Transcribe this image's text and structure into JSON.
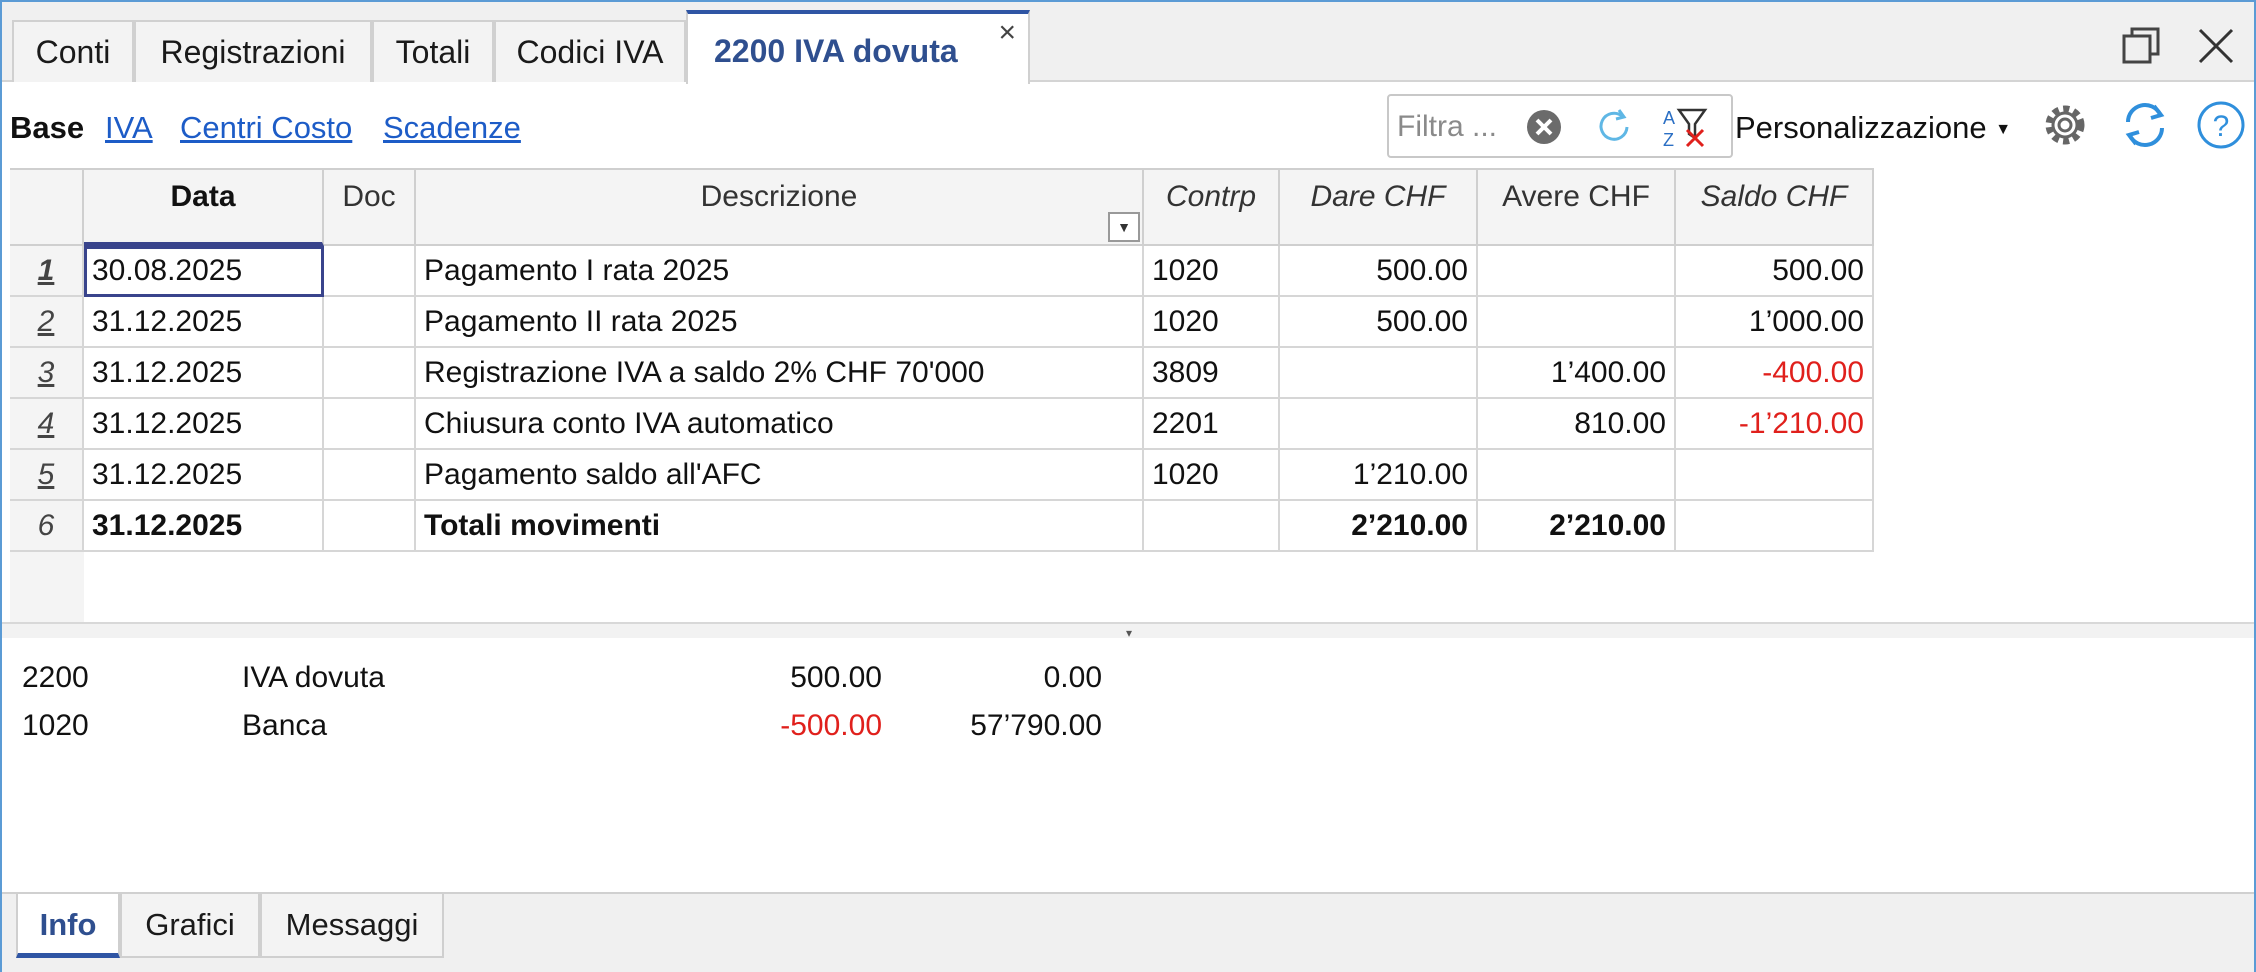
{
  "tabs": [
    {
      "label": "Conti"
    },
    {
      "label": "Registrazioni"
    },
    {
      "label": "Totali"
    },
    {
      "label": "Codici IVA"
    },
    {
      "label": "2200 IVA dovuta"
    }
  ],
  "tab_close_symbol": "×",
  "views": {
    "active": "Base",
    "links": [
      "IVA",
      "Centri Costo",
      "Scadenze"
    ]
  },
  "filter": {
    "placeholder": "Filtra ..."
  },
  "customize_label": "Personalizzazione",
  "icons": {
    "restore": "restore-window-icon",
    "close": "close-window-icon",
    "clear": "clear-filter-icon",
    "refresh": "refresh-filter-icon",
    "sort_filter": "sort-filter-icon",
    "settings": "gear-icon",
    "sync": "sync-icon",
    "help": "help-icon"
  },
  "colors": {
    "accent": "#2f55a4",
    "link": "#1d5cc7",
    "negative": "#e0201c"
  },
  "table": {
    "headers": [
      "Data",
      "Doc",
      "Descrizione",
      "Contrp",
      "Dare CHF",
      "Avere CHF",
      "Saldo CHF"
    ],
    "rows": [
      {
        "n": "1",
        "data": "30.08.2025",
        "doc": "",
        "descr": "Pagamento I rata 2025",
        "contrp": "1020",
        "dare": "500.00",
        "avere": "",
        "saldo": "500.00"
      },
      {
        "n": "2",
        "data": "31.12.2025",
        "doc": "",
        "descr": "Pagamento II rata 2025",
        "contrp": "1020",
        "dare": "500.00",
        "avere": "",
        "saldo": "1’000.00"
      },
      {
        "n": "3",
        "data": "31.12.2025",
        "doc": "",
        "descr": "Registrazione IVA a saldo 2% CHF 70'000",
        "contrp": "3809",
        "dare": "",
        "avere": "1’400.00",
        "saldo": "-400.00"
      },
      {
        "n": "4",
        "data": "31.12.2025",
        "doc": "",
        "descr": "Chiusura conto IVA automatico",
        "contrp": "2201",
        "dare": "",
        "avere": "810.00",
        "saldo": "-1’210.00"
      },
      {
        "n": "5",
        "data": "31.12.2025",
        "doc": "",
        "descr": "Pagamento saldo all'AFC",
        "contrp": "1020",
        "dare": "1’210.00",
        "avere": "",
        "saldo": ""
      },
      {
        "n": "6",
        "data": "31.12.2025",
        "doc": "",
        "descr": "Totali movimenti",
        "contrp": "",
        "dare": "2’210.00",
        "avere": "2’210.00",
        "saldo": ""
      }
    ]
  },
  "info": [
    {
      "account": "2200",
      "name": "IVA dovuta",
      "amount": "500.00",
      "balance": "0.00"
    },
    {
      "account": "1020",
      "name": "Banca",
      "amount": "-500.00",
      "balance": "57’790.00"
    }
  ],
  "bottom_tabs": [
    "Info",
    "Grafici",
    "Messaggi"
  ]
}
